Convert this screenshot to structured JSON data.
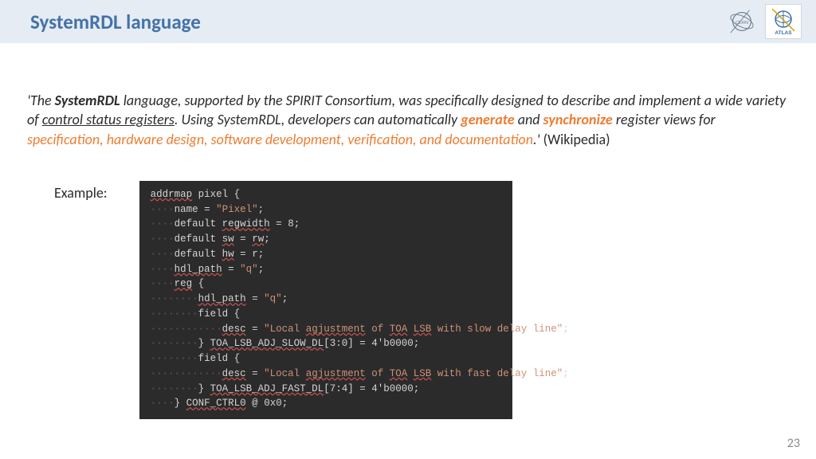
{
  "header": {
    "title": "SystemRDL language",
    "logos": [
      "CERN",
      "ATLAS"
    ]
  },
  "quote": {
    "prefix": "'The ",
    "bold1": "SystemRDL",
    "seg1": " language, supported by the SPIRIT Consortium, was specifically designed to describe and implement a wide variety of ",
    "underline1": "control status registers",
    "seg2": ". Using SystemRDL, developers can automatically ",
    "orange1": "generate",
    "seg3": " and ",
    "orange2": "synchronize",
    "seg4": " register views for ",
    "orange_italic": "specification, hardware design, software development, verification, and documentation",
    "seg5": ".' ",
    "cite": "(Wikipedia)"
  },
  "example_label": "Example:",
  "code": {
    "l01a": "addrmap",
    "l01b": " pixel {",
    "l02a": "name = ",
    "l02b": "\"Pixel\"",
    "l02c": ";",
    "l03a": "default ",
    "l03b": "regwidth",
    "l03c": " = ",
    "l03d": "8",
    "l03e": ";",
    "l04a": "default ",
    "l04b": "sw",
    "l04c": " = ",
    "l04d": "rw",
    "l04e": ";",
    "l05a": "default ",
    "l05b": "hw",
    "l05c": " = ",
    "l05d": "r",
    "l05e": ";",
    "l06a": "hdl_path",
    "l06b": " = ",
    "l06c": "\"q\"",
    "l06d": ";",
    "l07a": "reg",
    "l07b": " {",
    "l08a": "hdl_path",
    "l08b": " = ",
    "l08c": "\"q\"",
    "l08d": ";",
    "l09a": "field {",
    "l10a": "desc",
    "l10b": " = ",
    "l10c": "\"Local ",
    "l10d": "agjustment",
    "l10e": " of ",
    "l10f": "TOA",
    "l10g": " ",
    "l10h": "LSB",
    "l10i": " with slow delay line\"",
    "l10j": ";",
    "l11a": "} ",
    "l11b": "TOA_LSB_ADJ_SLOW_DL",
    "l11c": "[3:0] = ",
    "l11d": "4'b0000",
    "l11e": ";",
    "l12a": "field {",
    "l13a": "desc",
    "l13b": " = ",
    "l13c": "\"Local ",
    "l13d": "agjustment",
    "l13e": " of ",
    "l13f": "TOA",
    "l13g": " ",
    "l13h": "LSB",
    "l13i": " with fast delay line\"",
    "l13j": ";",
    "l14a": "} ",
    "l14b": "TOA_LSB_ADJ_FAST_DL",
    "l14c": "[7:4] = ",
    "l14d": "4'b0000",
    "l14e": ";",
    "l15a": "} ",
    "l15b": "CONF_CTRL0",
    "l15c": " @ ",
    "l15d": "0x0",
    "l15e": ";"
  },
  "page_number": "23"
}
